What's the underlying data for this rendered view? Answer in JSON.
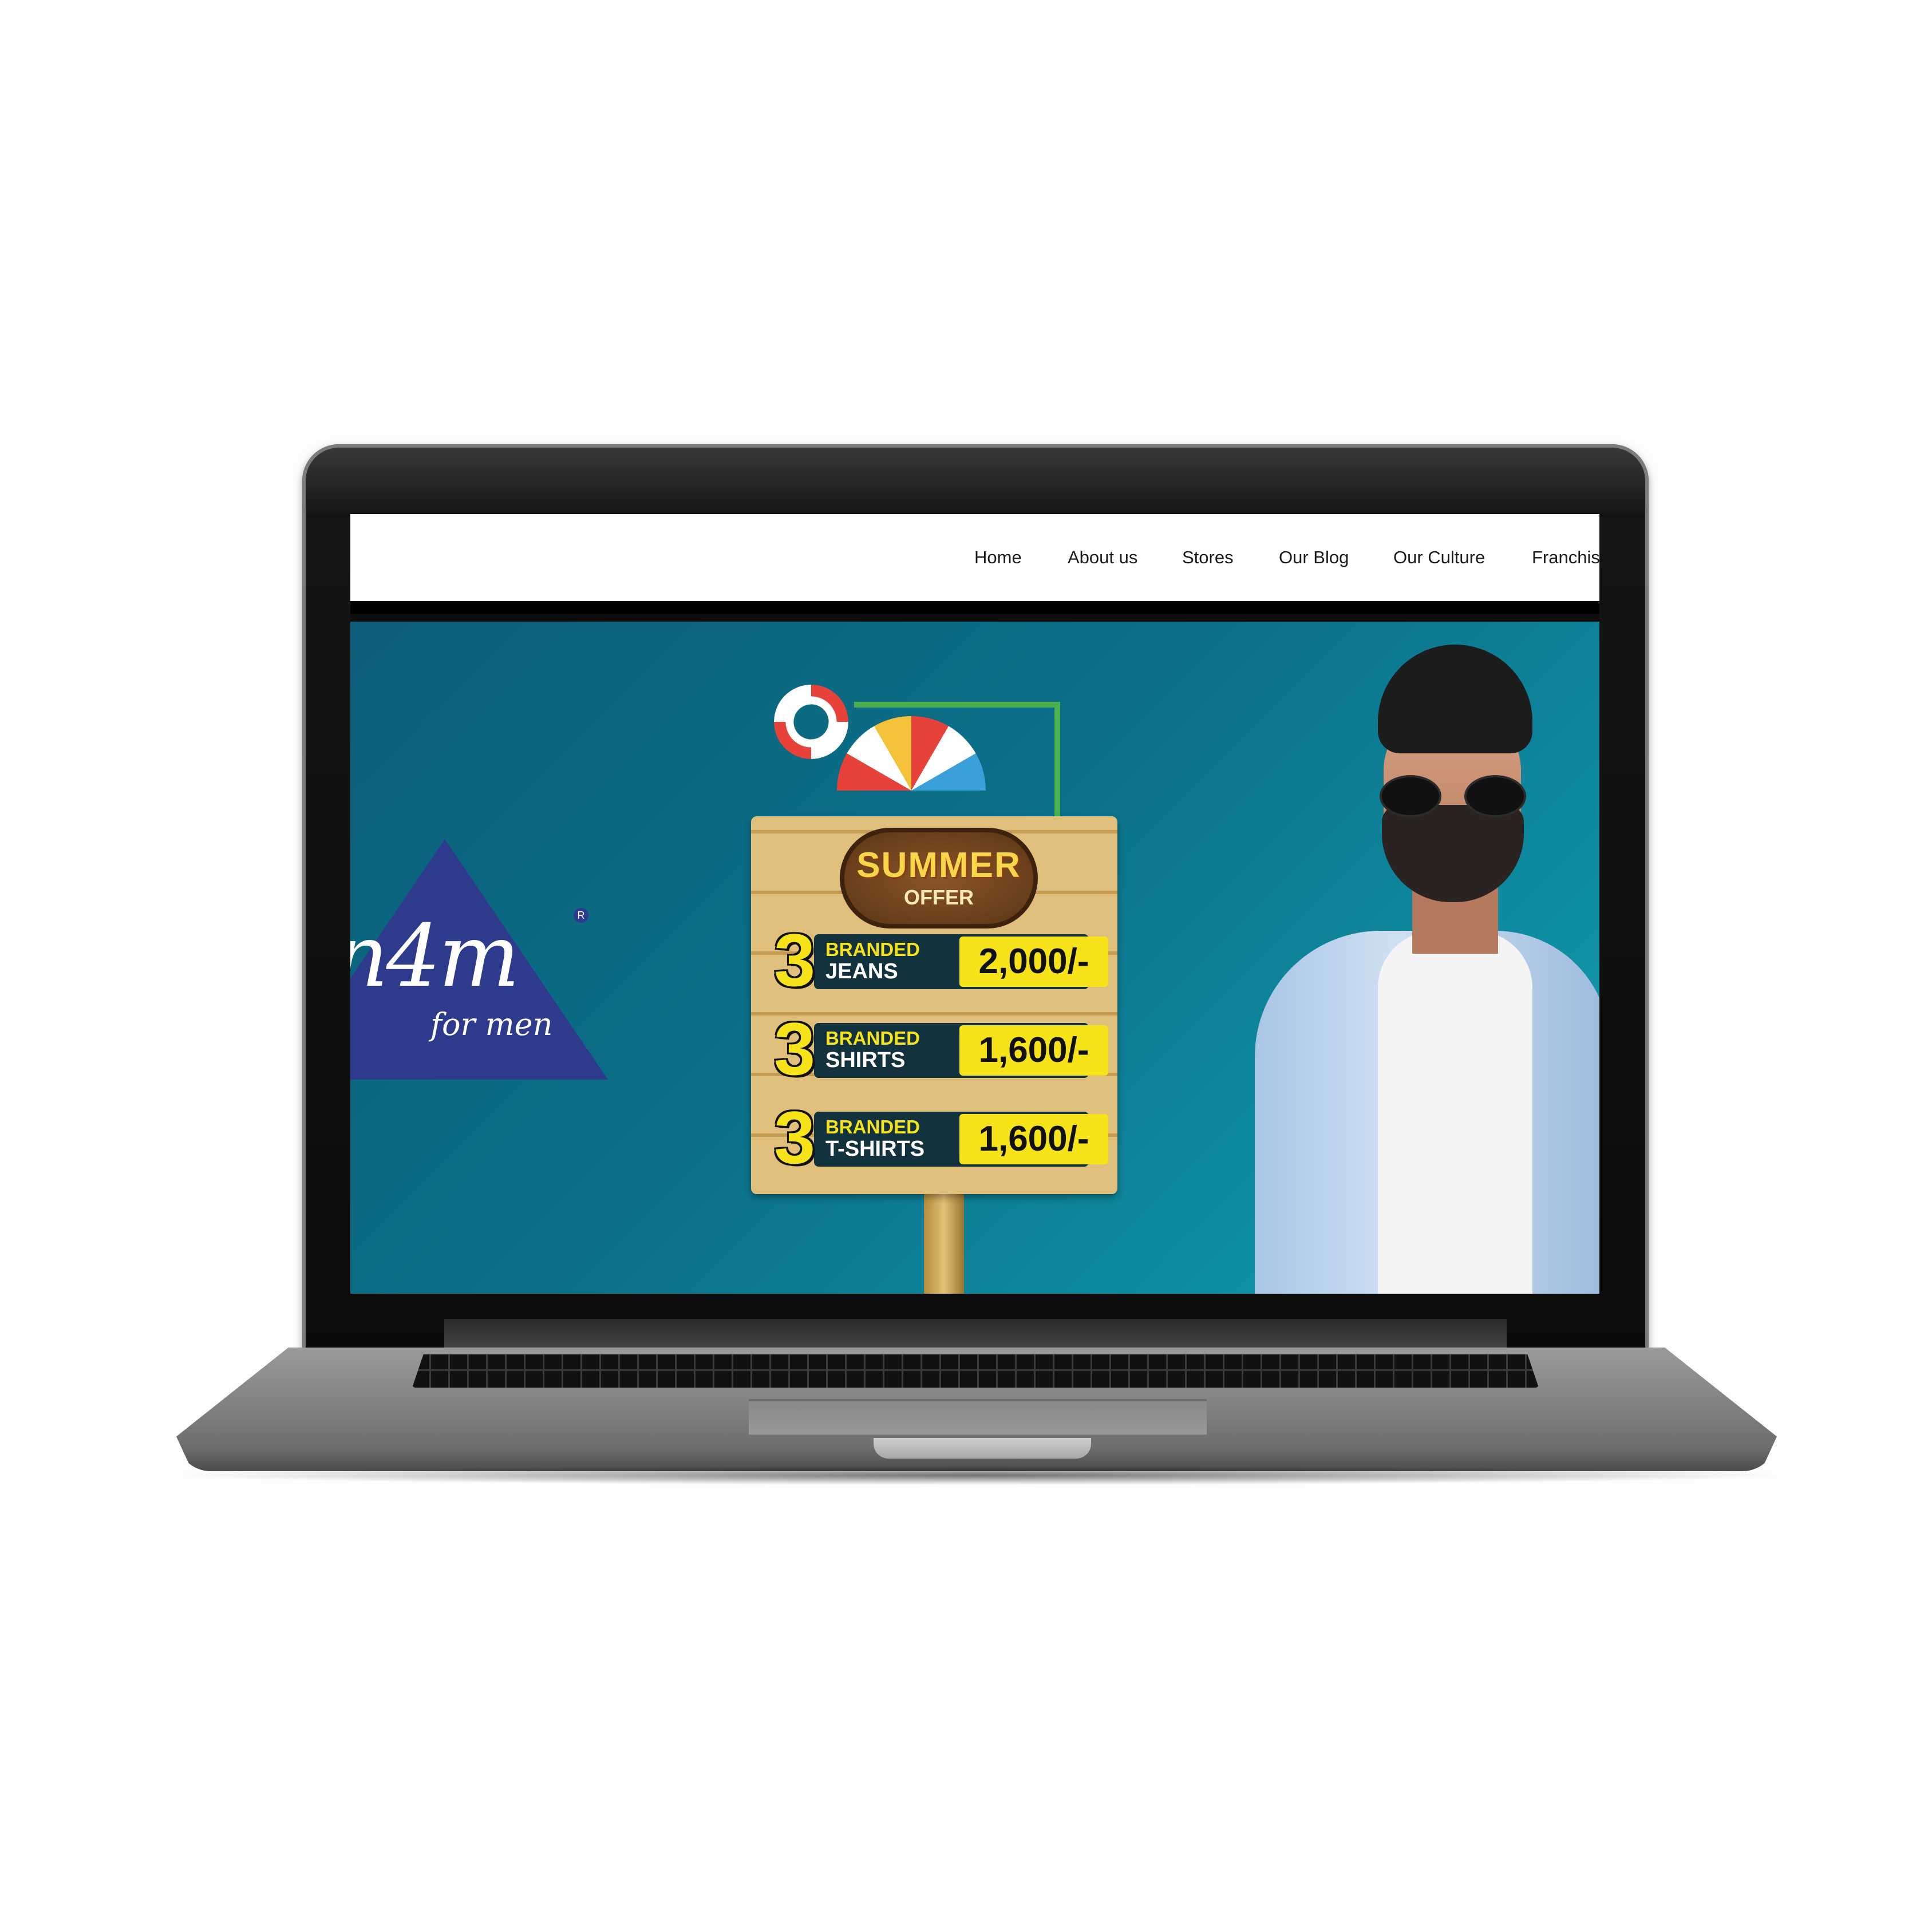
{
  "nav": {
    "items": [
      "Home",
      "About us",
      "Stores",
      "Our Blog",
      "Our Culture",
      "Franchis"
    ]
  },
  "logo": {
    "main": "n4m",
    "sub": "for men",
    "reg": "R"
  },
  "promo": {
    "title": "SUMMER",
    "subtitle": "OFFER",
    "offers": [
      {
        "qty": "3",
        "label1": "BRANDED",
        "label2": "JEANS",
        "price": "2,000/-"
      },
      {
        "qty": "3",
        "label1": "BRANDED",
        "label2": "SHIRTS",
        "price": "1,600/-"
      },
      {
        "qty": "3",
        "label1": "BRANDED",
        "label2": "T-SHIRTS",
        "price": "1,600/-"
      }
    ]
  },
  "colors": {
    "hero_bg": "#0b7088",
    "logo_blue": "#2e3a8c",
    "price_yellow": "#f7e319"
  },
  "icons": {
    "lifebuoy": "lifebuoy-icon",
    "umbrella": "beach-umbrella-icon"
  }
}
